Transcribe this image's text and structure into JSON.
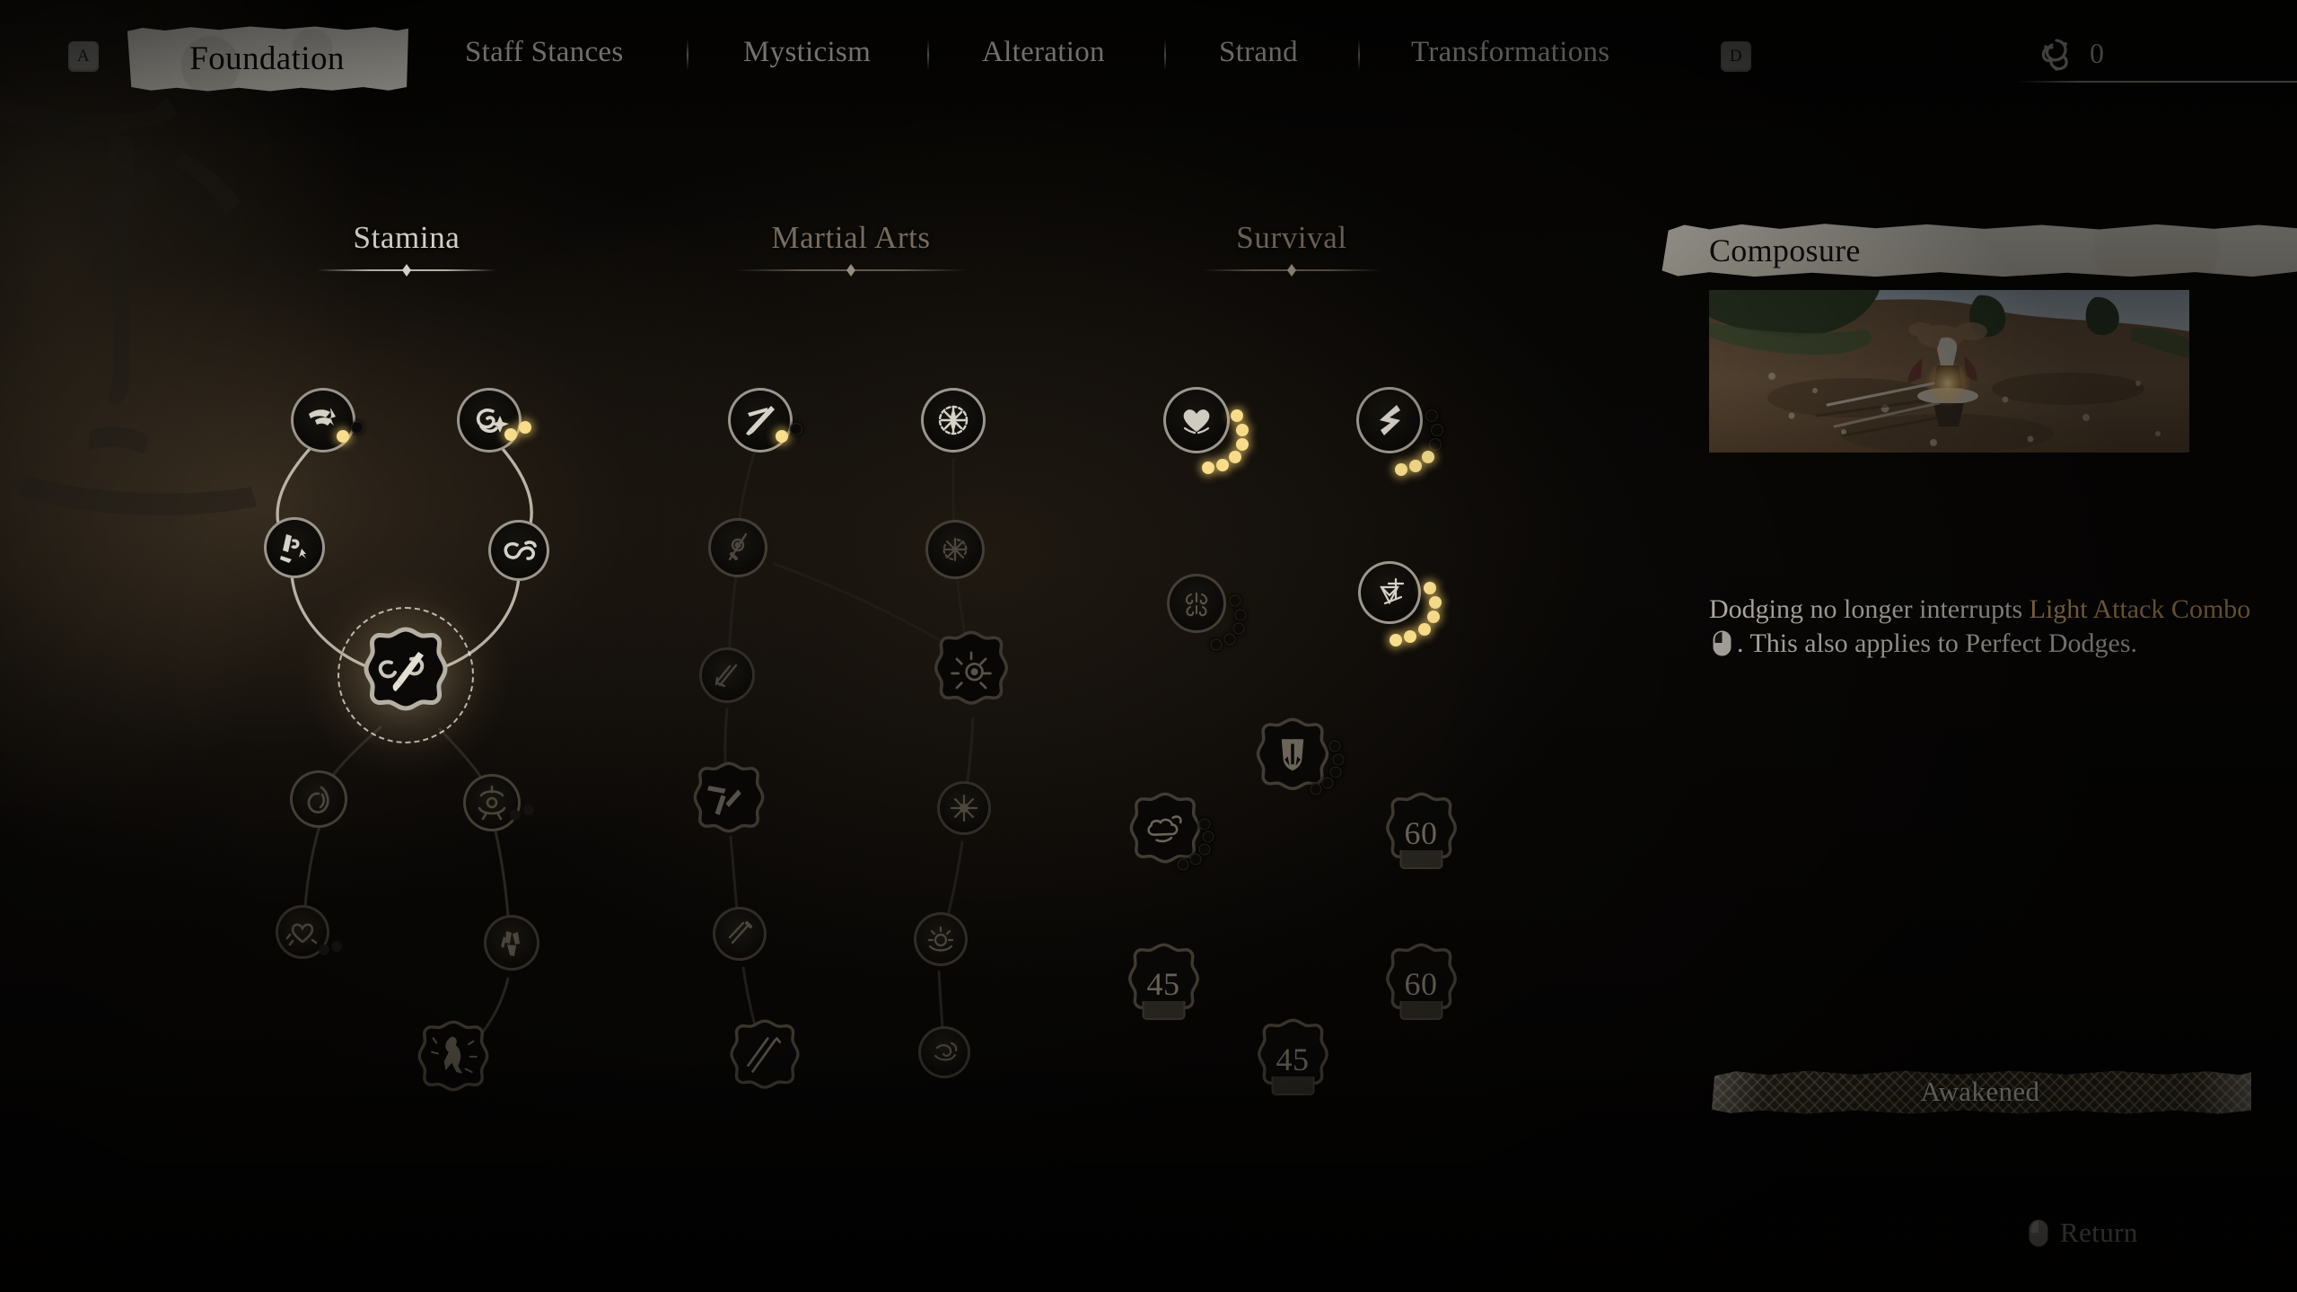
{
  "header": {
    "key_hint_left": "A",
    "key_hint_right": "D",
    "active_tab": "Foundation",
    "tabs": [
      "Staff Stances",
      "Mysticism",
      "Alteration",
      "Strand",
      "Transformations"
    ],
    "currency_icon": "spark-knot-icon",
    "currency_count": "0"
  },
  "tree": {
    "columns": [
      {
        "label": "Stamina",
        "state": "active"
      },
      {
        "label": "Martial Arts",
        "state": "inactive"
      },
      {
        "label": "Survival",
        "state": "inactive"
      }
    ]
  },
  "panel": {
    "title": "Composure",
    "preview_alt": "composure-preview-image",
    "description_part1": "Dodging no longer interrupts ",
    "description_highlight": "Light Attack Combo",
    "description_mouse_icon": "left-mouse-button-icon",
    "description_part2": ". This also applies to Perfect Dodges.",
    "awakened_label": "Awakened"
  },
  "footer": {
    "return_icon": "right-mouse-button-icon",
    "return_label": "Return"
  },
  "locked_levels": {
    "survival_r_top": "60",
    "survival_l_bottom": "45",
    "survival_r_bottom": "60",
    "survival_c_bottom": "45"
  },
  "colors": {
    "gold_pip": "#f7dd8c",
    "highlight_text": "#d6ab6c",
    "paper": "#ddd9ce",
    "body_text": "#ddd8ce"
  }
}
